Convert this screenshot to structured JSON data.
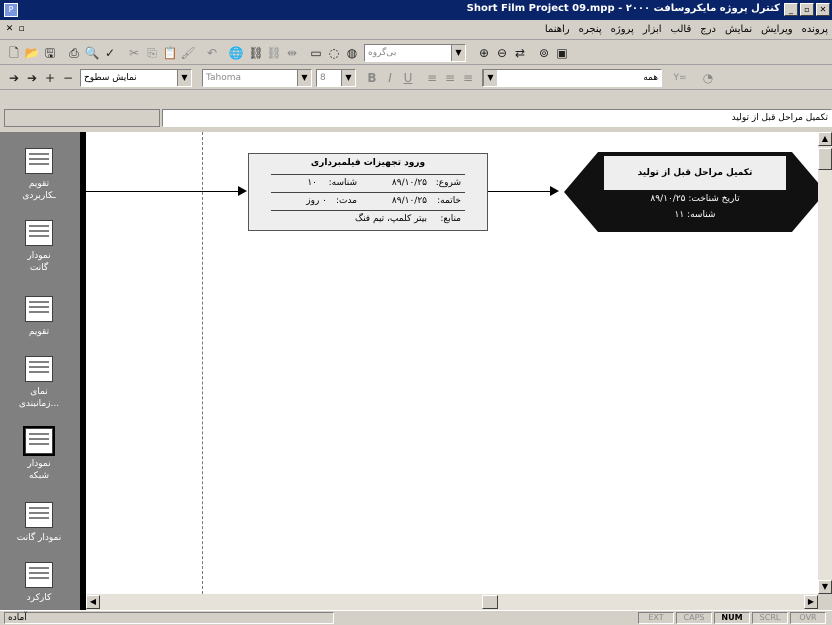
{
  "window": {
    "title": "Short Film Project 09.mpp - ۲۰۰۰ کنترل پروژه مایکروسافت",
    "app_icon": "project-icon",
    "buttons": [
      "_",
      "▫",
      "✕"
    ]
  },
  "menu": {
    "items": [
      "پرونده",
      "ویرایش",
      "نمایش",
      "درج",
      "قالب",
      "ابزار",
      "پروژه",
      "پنجره",
      "راهنما"
    ],
    "mdi_buttons": [
      "✕",
      "▫"
    ]
  },
  "toolbar1": {
    "zoom_combo": "بی‌گروه"
  },
  "toolbar2": {
    "show_combo": "نمایش سطوح",
    "font_combo": "Tahoma",
    "size_combo": "8",
    "bold": "B",
    "italic": "I",
    "underline": "U",
    "filter_combo": "همه",
    "autofilter": "Y="
  },
  "entry_bar": {
    "value": "تکمیل مراحل قبل از تولید"
  },
  "viewbar": {
    "items": [
      {
        "label": "تقویم",
        "sub": "ـکاربردی",
        "icon": "calendar-icon"
      },
      {
        "label": "نمودار",
        "sub": "گانت",
        "icon": "gantt-icon"
      },
      {
        "label": "تقویم",
        "sub": "",
        "icon": "calendar-view-icon"
      },
      {
        "label": "نمای",
        "sub": "زمانبندی...",
        "icon": "task-usage-icon"
      },
      {
        "label": "نمودار",
        "sub": "شبکه",
        "icon": "network-diagram-icon"
      },
      {
        "label": "نمودار گانت",
        "sub": "",
        "icon": "tracking-gantt-icon"
      },
      {
        "label": "کارکرد",
        "sub": "",
        "icon": "resource-icon"
      }
    ]
  },
  "node1": {
    "title": "ورود تجهیزات فیلمبرداری",
    "start_label": "شروع:",
    "start": "۸۹/۱۰/۲۵",
    "id_label": "شناسه:",
    "id": "۱۰",
    "finish_label": "خاتمه:",
    "finish": "۸۹/۱۰/۲۵",
    "dur_label": "مدت:",
    "dur": "۰ روز",
    "res_label": "منابع:",
    "res": "بیتر کلمپ، تیم فنگ"
  },
  "node2": {
    "title": "تکمیل مراحل قبل از تولید",
    "date_label": "تاریخ شناخت:",
    "date": "۸۹/۱۰/۲۵",
    "id_label": "شناسه:",
    "id": "۱۱"
  },
  "status": {
    "text": "آماده",
    "indicators": [
      "EXT",
      "CAPS",
      "NUM",
      "SCRL",
      "OVR"
    ],
    "active_indicator": "NUM"
  }
}
